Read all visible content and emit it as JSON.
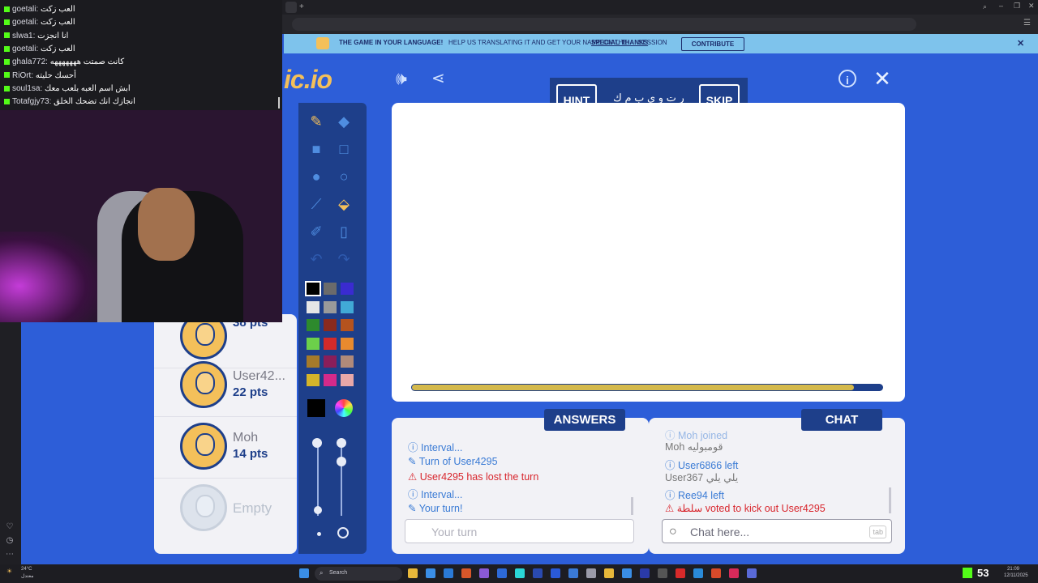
{
  "banner": {
    "text_prefix": "THE GAME IN YOUR LANGUAGE!",
    "text_main": "HELP US TRANSLATING IT AND GET YOUR NAME ON THE",
    "text_link": "SPECIAL THANKS",
    "text_suffix": "SESSION",
    "button": "CONTRIBUTE",
    "close": "✕"
  },
  "logo_partial": "ic.io",
  "word": {
    "hint_label": "HINT",
    "skip_label": "SKIP",
    "letters": "ر ت و ي ب م ك"
  },
  "players": [
    {
      "name": "",
      "points": "38 pts"
    },
    {
      "name": "User42...",
      "points": "22 pts"
    },
    {
      "name": "Moh",
      "points": "14 pts"
    },
    {
      "name": "Empty",
      "points": ""
    }
  ],
  "progress": {
    "value": 0.94
  },
  "answers": {
    "title": "ANSWERS",
    "lines": [
      {
        "text": "Interval...",
        "type": "info"
      },
      {
        "text": "Turn of User4295",
        "type": "turn"
      },
      {
        "text": "User4295 has lost the turn",
        "type": "warn"
      },
      {
        "text": "Interval...",
        "type": "info"
      },
      {
        "text": "Your turn!",
        "type": "turn"
      }
    ],
    "placeholder": "Your turn"
  },
  "chat": {
    "title": "CHAT",
    "lines": [
      {
        "text": "Moh joined",
        "type": "info"
      },
      {
        "text": "Moh قومبوليه",
        "type": "msg"
      },
      {
        "text": "User6866 left",
        "type": "info"
      },
      {
        "text": "User367 يلي يلي",
        "type": "msg"
      },
      {
        "text": "Ree94 left",
        "type": "info"
      },
      {
        "text": "سلطة voted to kick out User4295",
        "type": "warn"
      }
    ],
    "placeholder": "Chat here...",
    "tab_hint": "tab"
  },
  "stream_chat": [
    {
      "user": "goetali",
      "msg": "العب زكت"
    },
    {
      "user": "goetali",
      "msg": "العب زكت"
    },
    {
      "user": "slwa1",
      "msg": "انا انجزت"
    },
    {
      "user": "goetali",
      "msg": "العب زكت"
    },
    {
      "user": "ghala772",
      "msg": "كانت صمتت هههههههه"
    },
    {
      "user": "RiOrt",
      "msg": "أحسك حليته"
    },
    {
      "user": "soul1sa",
      "msg": "ابش اسم العبه بلعب معك"
    },
    {
      "user": "Totafgjy73",
      "msg": "انجازك انك تضحك الخلق"
    }
  ],
  "taskbar": {
    "weather": "24°C",
    "weather_sub": "معتدل",
    "search": "Search",
    "viewers": "53",
    "time": "21:09",
    "date": "12/11/2025"
  },
  "colors": {
    "primary": "#1e3f8a",
    "accent": "#3a7bd5",
    "warning": "#d8262d",
    "background": "#2d5ed8",
    "kick": "#53fc18"
  },
  "swatches": [
    "#000000",
    "#6b6b6b",
    "#3a2bd0",
    "#e6e6e6",
    "#9a9a9a",
    "#41a9d6",
    "#2d8a2d",
    "#8a2a1e",
    "#b5531e",
    "#6cd04a",
    "#d42a2a",
    "#e88a2e",
    "#a57a2a",
    "#8a1e5a",
    "#b08a7a",
    "#d4b42a",
    "#d42a8a",
    "#e8a8a8"
  ]
}
